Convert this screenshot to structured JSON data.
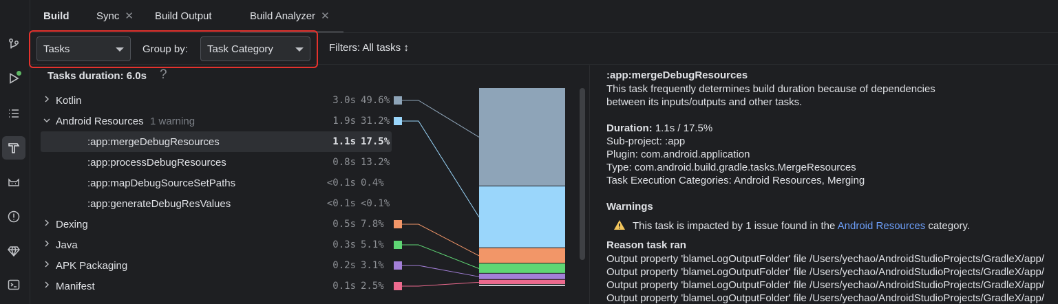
{
  "tabs": [
    {
      "label": "Build",
      "closable": false
    },
    {
      "label": "Sync",
      "closable": true
    },
    {
      "label": "Build Output",
      "closable": false
    },
    {
      "label": "Build Analyzer",
      "closable": true
    }
  ],
  "toolbar": {
    "view_combo": "Tasks",
    "group_by_label": "Group by:",
    "group_by_combo": "Task Category",
    "filters_label": "Filters: All tasks ↕"
  },
  "tasks": {
    "duration_title": "Tasks duration: 6.0s",
    "help": "?",
    "rows": [
      {
        "name": "Kotlin",
        "warning": "",
        "time": "3.0s",
        "pct": "49.6%",
        "expanded": false,
        "child": false
      },
      {
        "name": "Android Resources",
        "warning": "1 warning",
        "time": "1.9s",
        "pct": "31.2%",
        "expanded": true,
        "child": false
      },
      {
        "name": ":app:mergeDebugResources",
        "warning": "",
        "time": "1.1s",
        "pct": "17.5%",
        "child": true,
        "selected": true
      },
      {
        "name": ":app:processDebugResources",
        "warning": "",
        "time": "0.8s",
        "pct": "13.2%",
        "child": true
      },
      {
        "name": ":app:mapDebugSourceSetPaths",
        "warning": "",
        "time": "<0.1s",
        "pct": "0.4%",
        "child": true
      },
      {
        "name": ":app:generateDebugResValues",
        "warning": "",
        "time": "<0.1s",
        "pct": "<0.1%",
        "child": true
      },
      {
        "name": "Dexing",
        "warning": "",
        "time": "0.5s",
        "pct": "7.8%",
        "expanded": false,
        "child": false
      },
      {
        "name": "Java",
        "warning": "",
        "time": "0.3s",
        "pct": "5.1%",
        "expanded": false,
        "child": false
      },
      {
        "name": "APK Packaging",
        "warning": "",
        "time": "0.2s",
        "pct": "3.1%",
        "expanded": false,
        "child": false
      },
      {
        "name": "Manifest",
        "warning": "",
        "time": "0.1s",
        "pct": "2.5%",
        "expanded": false,
        "child": false
      }
    ]
  },
  "chart": {
    "segments": [
      {
        "category": "Kotlin",
        "fraction": 0.496,
        "color": "#8ea4b8"
      },
      {
        "category": "Android Resources",
        "fraction": 0.312,
        "color": "#9ad6fb"
      },
      {
        "category": "Dexing",
        "fraction": 0.078,
        "color": "#f29668"
      },
      {
        "category": "Java",
        "fraction": 0.051,
        "color": "#5fd674"
      },
      {
        "category": "APK Packaging",
        "fraction": 0.031,
        "color": "#a37fd8"
      },
      {
        "category": "Manifest",
        "fraction": 0.025,
        "color": "#ec6a8e"
      }
    ],
    "rest_color": "#c9ccd1"
  },
  "details": {
    "title": ":app:mergeDebugResources",
    "desc_1": "This task frequently determines build duration because of dependencies",
    "desc_2": "between its inputs/outputs and other tasks.",
    "duration_label": "Duration:",
    "duration_value": " 1.1s / 17.5%",
    "subproject": "Sub-project: :app",
    "plugin": "Plugin: com.android.application",
    "type": "Type: com.android.build.gradle.tasks.MergeResources",
    "categories": "Task Execution Categories: Android Resources, Merging",
    "warnings_title": "Warnings",
    "warning_pre": "This task is impacted by 1 issue found in the ",
    "warning_link": "Android Resources",
    "warning_post": " category.",
    "reason_title": "Reason task ran",
    "reasons": [
      "Output property 'blameLogOutputFolder' file /Users/yechao/AndroidStudioProjects/GradleX/app/",
      "Output property 'blameLogOutputFolder' file /Users/yechao/AndroidStudioProjects/GradleX/app/",
      "Output property 'blameLogOutputFolder' file /Users/yechao/AndroidStudioProjects/GradleX/app/",
      "Output property 'blameLogOutputFolder' file /Users/yechao/AndroidStudioProjects/GradleX/app/"
    ]
  },
  "colors": {
    "accent": "#6c9ef8",
    "highlight_border": "#e5322d",
    "run_badge": "#5fb865",
    "warning": "#f2c55c"
  }
}
